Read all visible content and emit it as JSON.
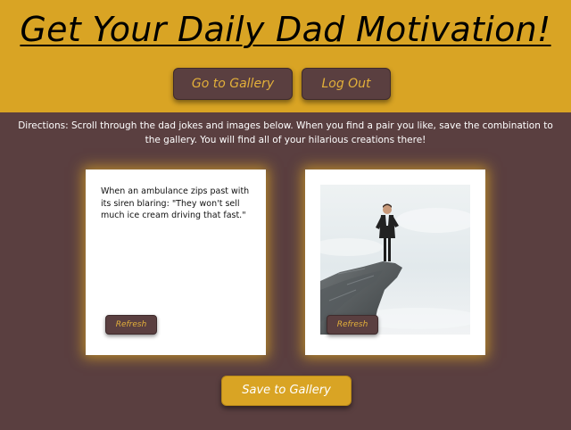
{
  "header": {
    "title": "Get Your Daily Dad Motivation!",
    "buttons": {
      "gallery_label": "Go to Gallery",
      "logout_label": "Log Out"
    }
  },
  "directions": "Directions: Scroll through the dad jokes and images below. When you find a pair you like, save the combination to the gallery. You will find all of your hilarious creations there!",
  "joke_card": {
    "joke": "When an ambulance zips past with its siren blaring: \"They won't sell much ice cream driving that fast.\"",
    "refresh_label": "Refresh"
  },
  "image_card": {
    "image_subject": "businessman-on-cliff-photo",
    "refresh_label": "Refresh"
  },
  "save_label": "Save to Gallery",
  "colors": {
    "header_bg": "#d9a424",
    "page_bg": "#5a3f40",
    "button_text": "#e3b03a",
    "card_glow": "#d9a424"
  }
}
